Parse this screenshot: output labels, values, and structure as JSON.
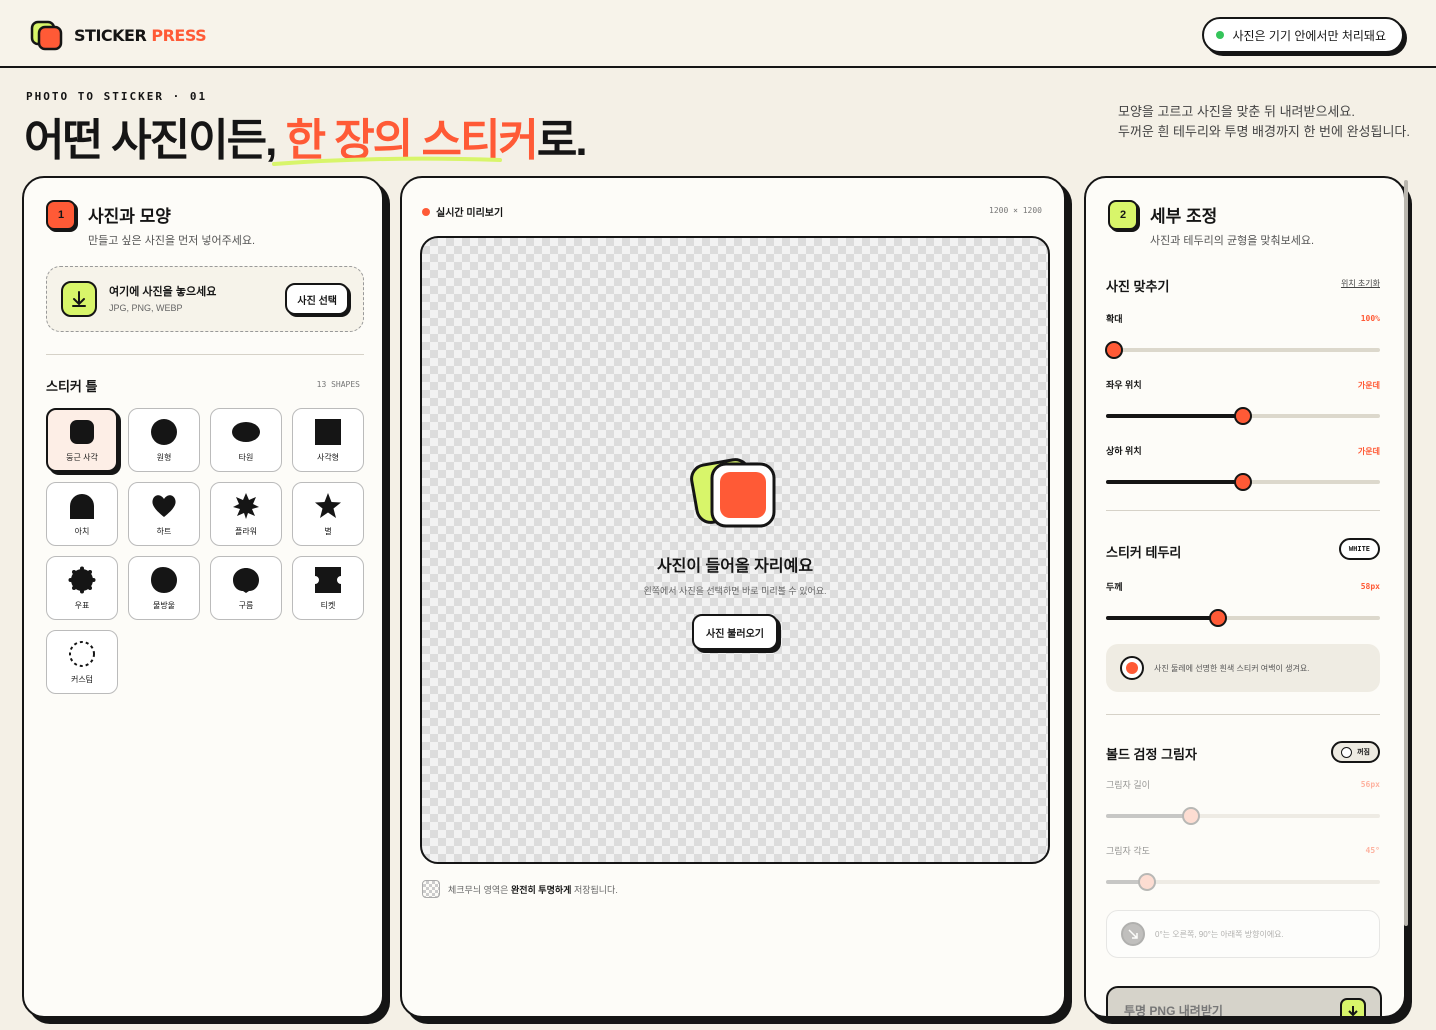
{
  "header": {
    "logo_main": "STICKER",
    "logo_accent": "PRESS",
    "privacy_badge": "사진은 기기 안에서만 처리돼요",
    "status_color": "#35c45a"
  },
  "hero": {
    "kicker": "PHOTO TO STICKER · 01",
    "headline_start": "어떤 사진이든,",
    "headline_accent": "한 장의 스티커",
    "headline_end": "로.",
    "tagline_line1": "모양을 고르고 사진을 맞춘 뒤 내려받으세요.",
    "tagline_line2": "두꺼운 흰 테두리와 투명 배경까지 한 번에 완성됩니다."
  },
  "left_panel": {
    "step": "1",
    "title": "사진과 모양",
    "subtitle": "만들고 싶은 사진을 먼저 넣어주세요.",
    "dropzone": {
      "title": "여기에 사진을 놓으세요",
      "formats": "JPG, PNG, WEBP",
      "button": "사진 선택"
    },
    "frames_label": "스티커 틀",
    "frames_count": "13 SHAPES",
    "shapes": [
      {
        "label": "둥근 사각",
        "icon": "rounded-square-icon",
        "selected": true
      },
      {
        "label": "원형",
        "icon": "circle-icon"
      },
      {
        "label": "타원",
        "icon": "ellipse-icon"
      },
      {
        "label": "사각형",
        "icon": "square-icon"
      },
      {
        "label": "아치",
        "icon": "arch-icon"
      },
      {
        "label": "하트",
        "icon": "heart-icon"
      },
      {
        "label": "플라워",
        "icon": "flower-icon"
      },
      {
        "label": "별",
        "icon": "star-icon"
      },
      {
        "label": "우표",
        "icon": "stamp-icon"
      },
      {
        "label": "물방울",
        "icon": "blob-icon"
      },
      {
        "label": "구름",
        "icon": "cloud-icon"
      },
      {
        "label": "티켓",
        "icon": "ticket-icon"
      },
      {
        "label": "커스텀",
        "icon": "custom-dashed-icon"
      }
    ]
  },
  "preview": {
    "live_label": "실시간 미리보기",
    "dimensions": "1200 × 1200",
    "empty_title": "사진이 들어올 자리예요",
    "empty_subtitle": "왼쪽에서 사진을 선택하면 바로 미리볼 수 있어요.",
    "load_button": "사진 불러오기",
    "note_prefix": "체크무늬 영역은 ",
    "note_bold": "완전히 투명하게",
    "note_suffix": " 저장됩니다."
  },
  "right_panel": {
    "step": "2",
    "title": "세부 조정",
    "subtitle": "사진과 테두리의 균형을 맞춰보세요.",
    "fit": {
      "title": "사진 맞추기",
      "reset": "위치 초기화",
      "zoom": {
        "label": "확대",
        "value": "100%",
        "level": 0.03
      },
      "horizontal": {
        "label": "좌우 위치",
        "value": "가운데",
        "level": 0.5
      },
      "vertical": {
        "label": "상하 위치",
        "value": "가운데",
        "level": 0.5
      }
    },
    "border": {
      "title": "스티커 테두리",
      "badge": "WHITE",
      "thickness": {
        "label": "두께",
        "value": "58px",
        "level": 0.41
      },
      "info": "사진 둘레에 선명한 흰색 스티커 여백이 생겨요."
    },
    "shadow": {
      "title": "볼드 검정 그림자",
      "toggle": "꺼짐",
      "length": {
        "label": "그림자 길이",
        "value": "56px",
        "level": 0.31
      },
      "angle": {
        "label": "그림자 각도",
        "value": "45°",
        "level": 0.15
      },
      "info": "0°는 오른쪽, 90°는 아래쪽 방향이에요."
    },
    "download_button": "투명 PNG 내려받기"
  },
  "colors": {
    "accent": "#ff5a36",
    "lime": "#d8f56a",
    "ink": "#151515",
    "background": "#f4f0e6"
  }
}
